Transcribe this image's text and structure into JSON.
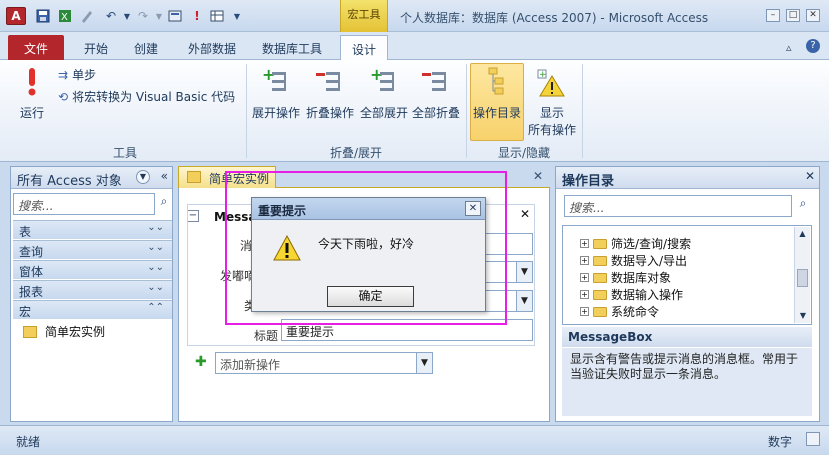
{
  "window": {
    "title": "个人数据库：数据库 (Access 2007)  -  Microsoft Access",
    "context_tab_group": "宏工具"
  },
  "tabs": [
    {
      "label": "文件"
    },
    {
      "label": "开始"
    },
    {
      "label": "创建"
    },
    {
      "label": "外部数据"
    },
    {
      "label": "数据库工具"
    },
    {
      "label": "设计"
    }
  ],
  "ribbon": {
    "tools_group": {
      "run": "运行",
      "single_step": "单步",
      "convert": "将宏转换为 Visual Basic 代码",
      "label": "工具"
    },
    "collapse_group": {
      "expand_action": "展开操作",
      "collapse_action": "折叠操作",
      "expand_all": "全部展开",
      "collapse_all": "全部折叠",
      "label": "折叠/展开"
    },
    "show_group": {
      "action_catalog": "操作目录",
      "show_all_1": "显示",
      "show_all_2": "所有操作",
      "label": "显示/隐藏"
    }
  },
  "nav_pane": {
    "title": "所有 Access 对象",
    "search_placeholder": "搜索...",
    "categories": [
      {
        "label": "表"
      },
      {
        "label": "查询"
      },
      {
        "label": "窗体"
      },
      {
        "label": "报表"
      },
      {
        "label": "宏"
      }
    ],
    "macro_item": "简单宏实例"
  },
  "document": {
    "tab_label": "简单宏实例",
    "block_label": "Messa",
    "row1_label": "消",
    "row2_label": "发嘟嘀",
    "row3_label": "类",
    "title_label": "标题",
    "title_value": "重要提示",
    "add_action_placeholder": "添加新操作"
  },
  "dialog": {
    "title": "重要提示",
    "message": "今天下雨啦，好冷",
    "ok": "确定",
    "close": "✕"
  },
  "catalog_pane": {
    "title": "操作目录",
    "search_placeholder": "搜索...",
    "tree_items": [
      {
        "label": "筛选/查询/搜索"
      },
      {
        "label": "数据导入/导出"
      },
      {
        "label": "数据库对象"
      },
      {
        "label": "数据输入操作"
      },
      {
        "label": "系统命令"
      }
    ],
    "detail_title": "MessageBox",
    "detail_text": "显示含有警告或提示消息的消息框。常用于当验证失败时显示一条消息。"
  },
  "status": {
    "left": "就绪",
    "right": "数字"
  },
  "colors": {
    "file_tab": "#b3262c",
    "highlight": "#e61ee6",
    "context_tab": "#e4c235"
  }
}
